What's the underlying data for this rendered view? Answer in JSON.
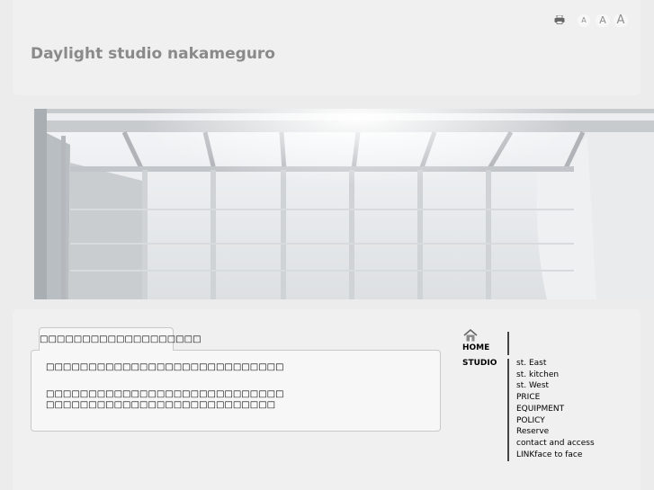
{
  "header": {
    "site_title": "Daylight studio nakameguro",
    "tools": {
      "print_icon": "printer-icon",
      "font_small": "A",
      "font_medium": "A",
      "font_large": "A"
    }
  },
  "hero": {
    "image": "greenhouse-studio-interior"
  },
  "main": {
    "tab_label": "□□□□□□□□□□□□□□□□□□□",
    "paragraphs": [
      "□□□□□□□□□□□□□□□□□□□□□□□□□□□□",
      "□□□□□□□□□□□□□□□□□□□□□□□□□□□□",
      "□□□□□□□□□□□□□□□□□□□□□□□□□□□"
    ]
  },
  "nav": {
    "home_icon": "house-icon",
    "home": "HOME",
    "studio": "STUDIO",
    "studio_items": [
      "st. East",
      "st. kitchen",
      "st. West",
      "PRICE",
      "EQUIPMENT",
      "POLICY",
      "Reserve",
      "contact and access",
      "LINKface to face"
    ]
  },
  "colors": {
    "background": "#ececec",
    "panel": "#f0f0f0",
    "title": "#8a8a8a"
  }
}
